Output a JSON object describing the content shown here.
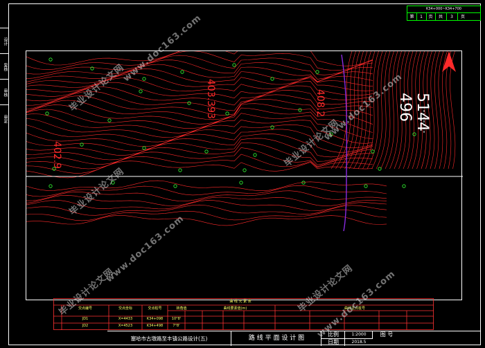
{
  "sheet": {
    "code": "K34+000~K34+700",
    "page_label": "第",
    "page_no": "1",
    "page_unit": "页",
    "total_label": "共",
    "total_no": "3",
    "total_unit": "页"
  },
  "left_strip": [
    "设计",
    "复核",
    "审核",
    "审定"
  ],
  "map": {
    "contour_labels": [
      "5144",
      "496",
      "403.393",
      "408.2",
      "402.9"
    ],
    "north": "N"
  },
  "title_block": {
    "caption": "曲 线 元 素 表",
    "headers": [
      "交点编号",
      "交点坐标",
      "交点桩号",
      "转角值",
      "曲线要素值(m)",
      "曲线主点桩号"
    ],
    "rows": [
      [
        "JD1",
        "X=4433",
        "K34+098",
        "10°8'"
      ],
      [
        "JD2",
        "X=4523",
        "K34+498",
        "7°8'"
      ]
    ]
  },
  "bottom": {
    "project": "塞哈市古墩路至丰镇公路设计(五)",
    "drawing_title": "路 线 平 面 设 计 图",
    "scale_label": "比例",
    "scale_value": "1:2000",
    "drawing_no_label": "图 号",
    "date_label": "日期",
    "date_value": "2018.5"
  },
  "watermark": {
    "text1": "毕业设计论文网",
    "text2": "www.doc163.com"
  },
  "colors": {
    "contour": "#ff2a2a",
    "title_block": "#ff3333",
    "road": "#ffffff",
    "marker": "#33ff33",
    "route": "#8a2be2"
  }
}
